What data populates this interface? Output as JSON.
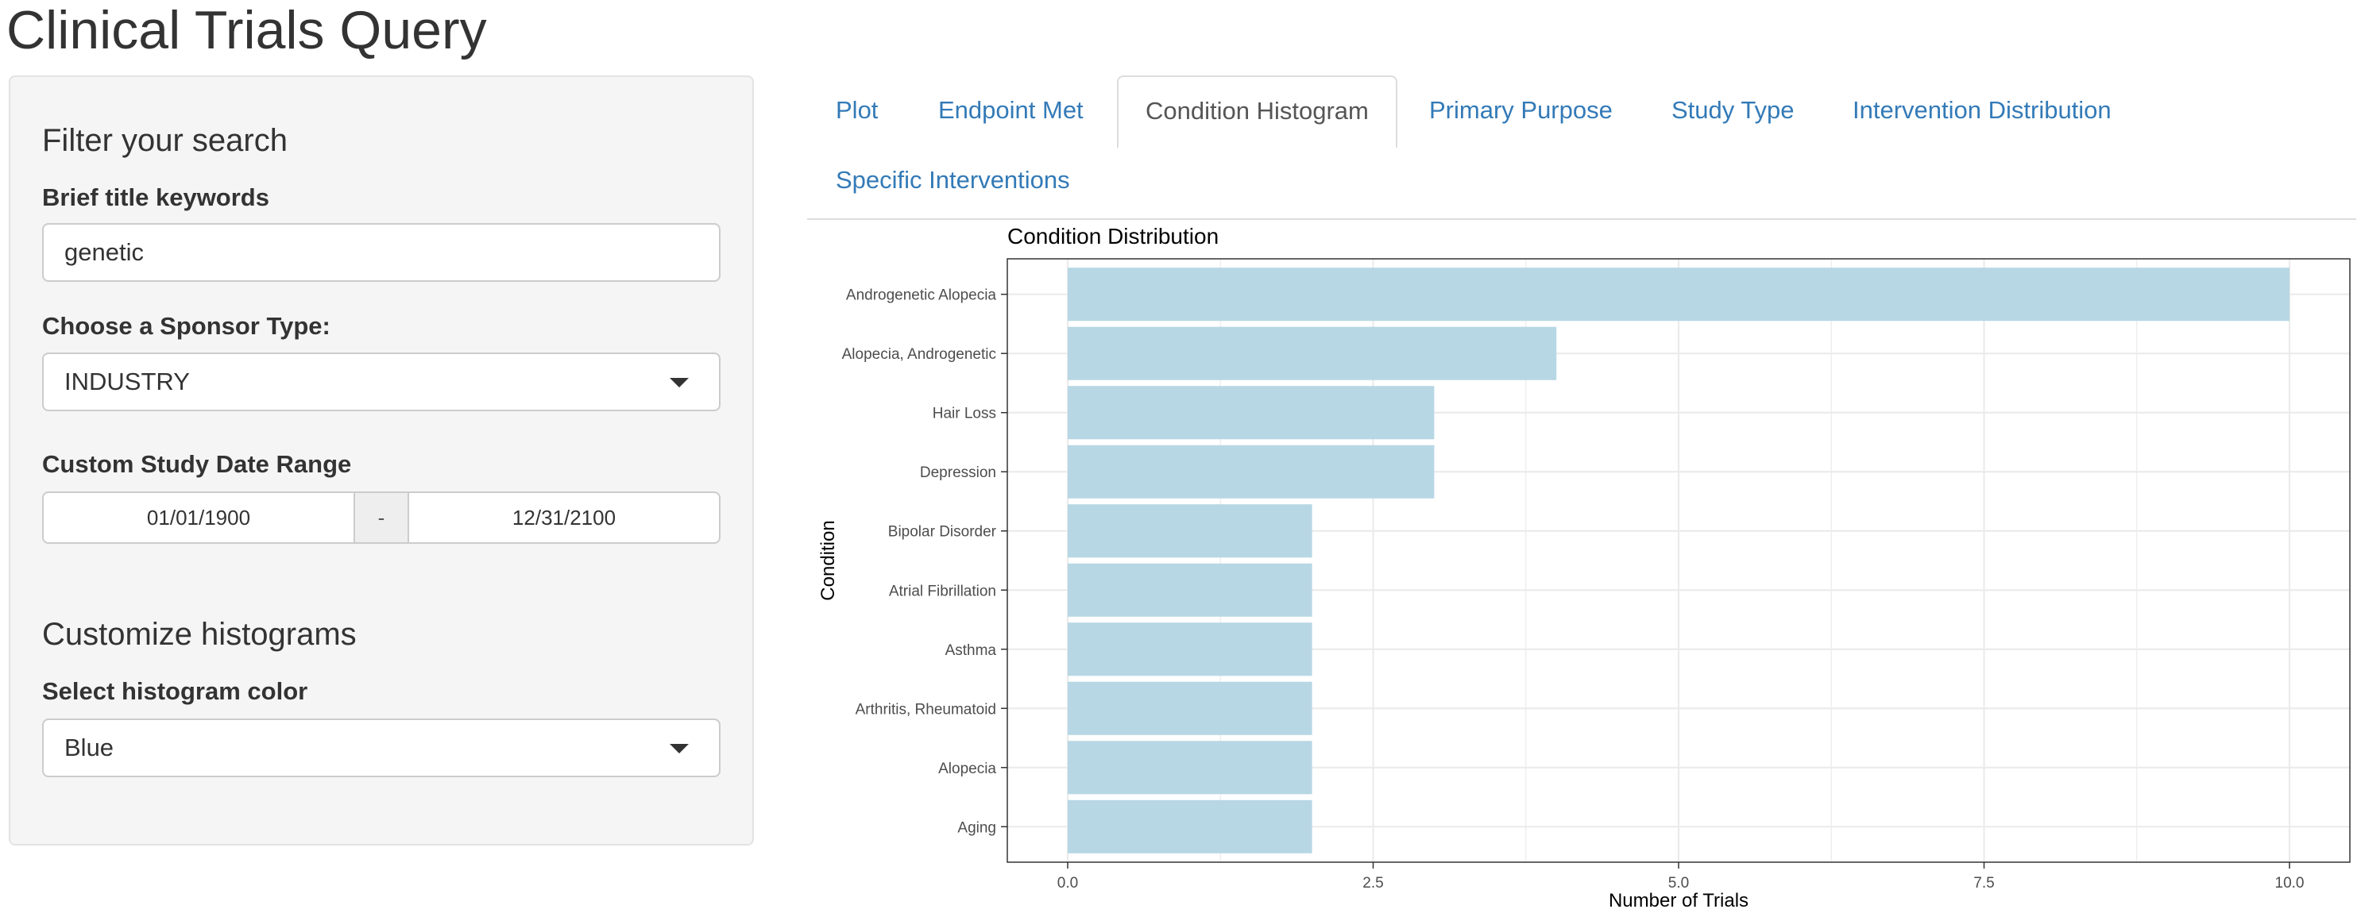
{
  "app": {
    "title": "Clinical Trials Query"
  },
  "sidebar": {
    "filter_heading": "Filter your search",
    "keywords_label": "Brief title keywords",
    "keywords_value": "genetic",
    "sponsor_label": "Choose a Sponsor Type:",
    "sponsor_value": "INDUSTRY",
    "date_label": "Custom Study Date Range",
    "date_start": "01/01/1900",
    "date_separator": "-",
    "date_end": "12/31/2100",
    "customize_heading": "Customize histograms",
    "color_label": "Select histogram color",
    "color_value": "Blue"
  },
  "tabs": [
    {
      "label": "Plot",
      "active": false
    },
    {
      "label": "Endpoint Met",
      "active": false
    },
    {
      "label": "Condition Histogram",
      "active": true
    },
    {
      "label": "Primary Purpose",
      "active": false
    },
    {
      "label": "Study Type",
      "active": false
    },
    {
      "label": "Intervention Distribution",
      "active": false
    },
    {
      "label": "Specific Interventions",
      "active": false
    }
  ],
  "colors": {
    "bar_fill": "#b7d7e4",
    "link": "#337ab7",
    "grid": "#ebebeb"
  },
  "chart_data": {
    "type": "bar",
    "orientation": "horizontal",
    "title": "Condition Distribution",
    "xlabel": "Number of Trials",
    "ylabel": "Condition",
    "categories": [
      "Androgenetic Alopecia",
      "Alopecia, Androgenetic",
      "Hair Loss",
      "Depression",
      "Bipolar Disorder",
      "Atrial Fibrillation",
      "Asthma",
      "Arthritis, Rheumatoid",
      "Alopecia",
      "Aging"
    ],
    "values": [
      10,
      4,
      3,
      3,
      2,
      2,
      2,
      2,
      2,
      2
    ],
    "xlim": [
      0,
      10
    ],
    "xticks": [
      0,
      2.5,
      5,
      7.5,
      10
    ],
    "xtick_labels": [
      "0.0",
      "2.5",
      "5.0",
      "7.5",
      "10.0"
    ],
    "grid": true
  }
}
